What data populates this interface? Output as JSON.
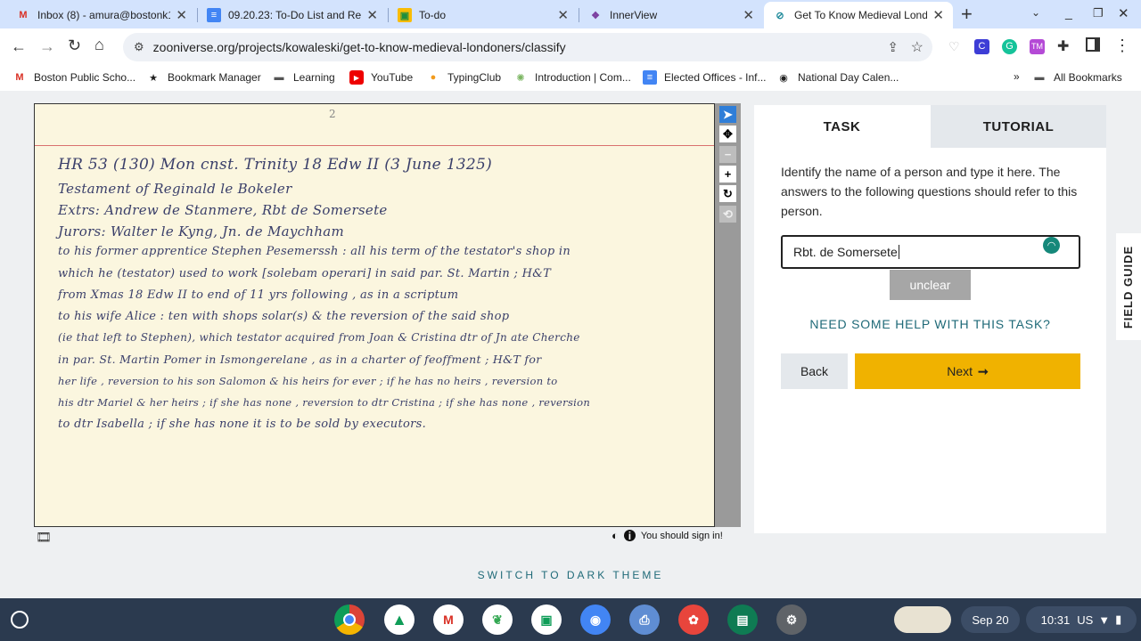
{
  "tabs": [
    {
      "title": "Inbox (8) - amura@bostonk1",
      "icon": "gmail-icon",
      "active": false
    },
    {
      "title": "09.20.23: To-Do List and Re",
      "icon": "docs-icon",
      "active": false
    },
    {
      "title": "To-do",
      "icon": "classroom-icon",
      "active": false
    },
    {
      "title": "InnerView",
      "icon": "innerview-icon",
      "active": false
    },
    {
      "title": "Get To Know Medieval Lond",
      "icon": "zooniverse-icon",
      "active": true
    }
  ],
  "address": {
    "url": "zooniverse.org/projects/kowaleski/get-to-know-medieval-londoners/classify"
  },
  "bookmarks": [
    "Boston Public Scho...",
    "Bookmark Manager",
    "Learning",
    "YouTube",
    "TypingClub",
    "Introduction | Com...",
    "Elected Offices - Inf...",
    "National Day Calen...",
    "All Bookmarks"
  ],
  "manuscript": {
    "page_marker": "2",
    "lines": [
      "HR 53 (130)    Mon  cnst. Trinity  18 Edw II   (3 June 1325)",
      "Testament  of   Reginald  le  Bokeler",
      "Extrs:  Andrew  de  Stanmere,  Rbt de  Somersete",
      "Jurors:  Walter le Kyng,  Jn. de  Maychham",
      "to  his former apprentice  Stephen  Pesemerssh :  all  his  term  of  the testator's  shop  in",
      "which  he  (testator)  used  to  work  [solebam operari]  in  said  par.  St. Martin ;  H&T",
      "from  Xmas  18 Edw II  to  end  of  11 yrs  following ,  as  in  a  scriptum",
      "to  his  wife  Alice :  ten  with  shops  solar(s)  &  the  reversion  of  the  said  shop",
      "(ie that left to Stephen),  which  testator  acquired  from  Joan  &  Cristina  dtr of  Jn ate  Cherche",
      "in  par.  St. Martin  Pomer   in   Ismongerelane ,  as  in  a  charter  of  feoffment ;  H&T  for",
      "her  life ,  reversion  to  his  son   Salomon   &  his heirs  for  ever ;  if  he has  no  heirs ,  reversion to",
      "his  dtr  Mariel  &  her  heirs ;  if  she  has  none ,  reversion  to  dtr  Cristina ;  if  she  has  none ,  reversion",
      "to  dtr  Isabella ;   if  she  has  none   it  is   to  be  sold   by  executors."
    ]
  },
  "task_panel": {
    "tab_task": "TASK",
    "tab_tutorial": "TUTORIAL",
    "instruction": "Identify the name of a person and type it here. The answers to the following questions should refer to this person.",
    "answer_value": "Rbt. de Somersete",
    "unclear_label": "unclear",
    "help_label": "NEED SOME HELP WITH THIS TASK?",
    "back_label": "Back",
    "next_label": "Next"
  },
  "field_guide_label": "FIELD GUIDE",
  "signin_text": "You should sign in!",
  "dark_theme_label": "SWITCH TO DARK THEME",
  "shelf": {
    "date": "Sep 20",
    "time": "10:31",
    "locale": "US"
  },
  "colors": {
    "accent": "#f0b200",
    "link": "#1f6a78",
    "tabstrip": "#d3e3fd",
    "shelf": "#2b3a4f"
  }
}
